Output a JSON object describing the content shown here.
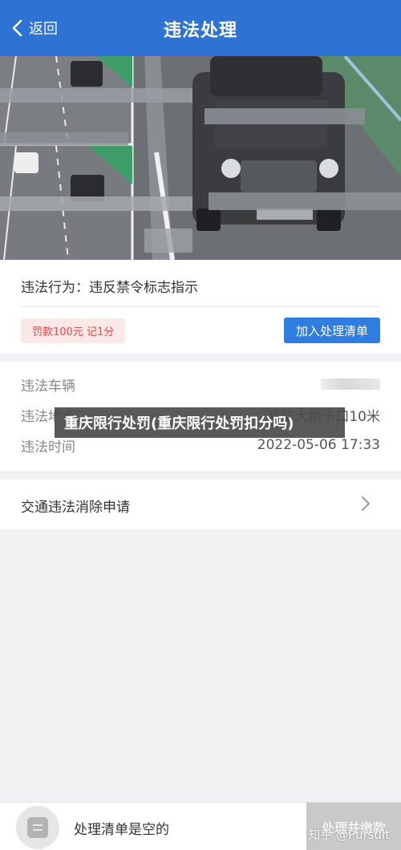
{
  "nav": {
    "back_label": "返回",
    "title": "违法处理"
  },
  "violation": {
    "behavior": "违法行为：违反禁令标志指示",
    "fine": "罚款100元 记1分",
    "add_button": "加入处理清单"
  },
  "details": {
    "vehicle_label": "违法车辆",
    "location_label": "违法地点",
    "location_value": "嘉华大桥卡口10米",
    "time_label": "违法时间",
    "time_value": "2022-05-06 17:33"
  },
  "overlay_banner": "重庆限行处罚(重庆限行处罚扣分吗)",
  "appeal": {
    "label": "交通违法消除申请"
  },
  "bottom_bar": {
    "empty_text": "处理清单是空的",
    "pay_button": "处理并缴款"
  },
  "watermark": "知乎 @Pursuit",
  "colors": {
    "nav": "#2e73d4",
    "primary_button": "#2f7de1",
    "fine_text": "#e14b4b",
    "fine_bg": "#fde8e8"
  }
}
